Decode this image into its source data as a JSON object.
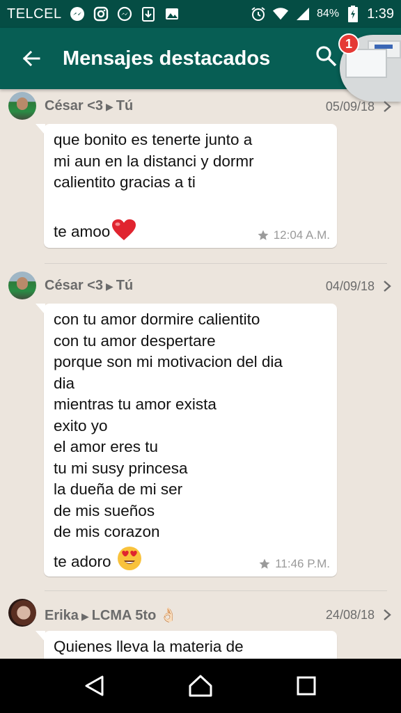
{
  "status_bar": {
    "carrier": "TELCEL",
    "battery_percent": "84%",
    "time": "1:39",
    "left_icons": [
      "messenger-icon",
      "instagram-icon",
      "messenger-icon",
      "download-icon",
      "gallery-icon"
    ],
    "right_icons": [
      "alarm-icon",
      "wifi-icon",
      "signal-icon",
      "battery-icon"
    ]
  },
  "app_bar": {
    "title": "Mensajes destacados",
    "color": "#075e54",
    "chat_head_badge": "1"
  },
  "messages": [
    {
      "sender": "César <3",
      "recipient": "Tú",
      "date": "05/09/18",
      "lines": [
        "que bonito es tenerte junto a",
        "mi aun en la distanci y dormr",
        "calientito gracias a ti",
        "",
        "te amoo"
      ],
      "emoji": "red-heart",
      "time": "12:04 A.M."
    },
    {
      "sender": "César <3",
      "recipient": "Tú",
      "date": "04/09/18",
      "lines": [
        "con tu amor dormire calientito",
        "con tu amor despertare",
        "porque son mi motivacion del dia",
        "dia",
        "mientras tu amor exista",
        "exito yo",
        "el amor eres tu",
        "tu mi susy princesa",
        "la dueña de mi ser",
        "de mis sueños",
        "de mis corazon",
        "te adoro"
      ],
      "emoji": "heart-eyes",
      "time": "11:46 P.M."
    },
    {
      "sender": "Erika",
      "recipient": "LCMA 5to 👌🏻",
      "date": "24/08/18",
      "lines": [
        "Quienes lleva la materia de"
      ],
      "time": ""
    }
  ]
}
